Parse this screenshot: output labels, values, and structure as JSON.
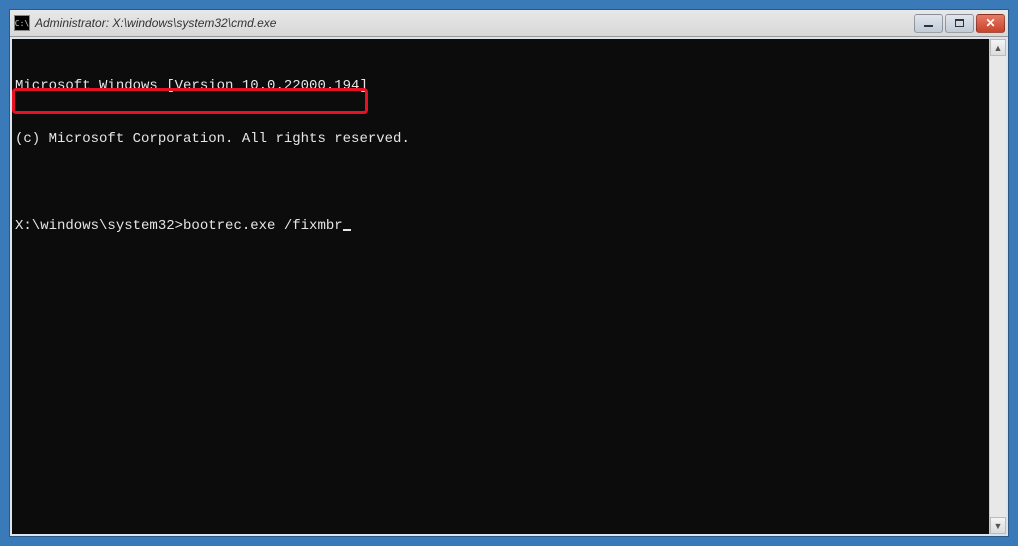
{
  "titlebar": {
    "icon_label": "C:\\",
    "title": "Administrator: X:\\windows\\system32\\cmd.exe"
  },
  "window_controls": {
    "minimize_glyph": "",
    "maximize_glyph": "",
    "close_glyph": "✕"
  },
  "terminal": {
    "line1": "Microsoft Windows [Version 10.0.22000.194]",
    "line2": "(c) Microsoft Corporation. All rights reserved.",
    "blank": "",
    "prompt": "X:\\windows\\system32>",
    "command": "bootrec.exe /fixmbr"
  },
  "scrollbar": {
    "up": "▲",
    "down": "▼"
  }
}
